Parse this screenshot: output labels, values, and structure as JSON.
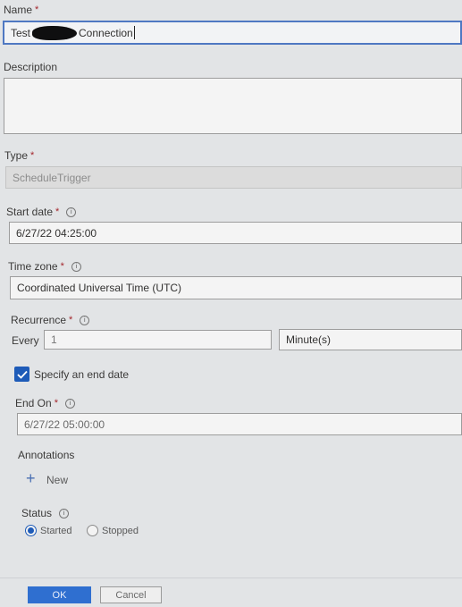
{
  "name": {
    "label": "Name",
    "required_mark": "*",
    "value_prefix": "Test",
    "value_suffix": "Connection"
  },
  "description": {
    "label": "Description",
    "value": ""
  },
  "type": {
    "label": "Type",
    "required_mark": "*",
    "value": "ScheduleTrigger"
  },
  "start_date": {
    "label": "Start date",
    "required_mark": "*",
    "value": "6/27/22 04:25:00"
  },
  "time_zone": {
    "label": "Time zone",
    "required_mark": "*",
    "value": "Coordinated Universal Time (UTC)"
  },
  "recurrence": {
    "label": "Recurrence",
    "required_mark": "*",
    "every_label": "Every",
    "interval": "1",
    "unit": "Minute(s)"
  },
  "end_date_toggle": {
    "label": "Specify an end date",
    "checked": true
  },
  "end_on": {
    "label": "End On",
    "required_mark": "*",
    "value": "6/27/22 05:00:00"
  },
  "annotations": {
    "label": "Annotations",
    "new_label": "New"
  },
  "status": {
    "label": "Status",
    "options": [
      "Started",
      "Stopped"
    ],
    "selected": "Started"
  },
  "footer": {
    "ok_label": "OK",
    "cancel_label": "Cancel"
  },
  "colors": {
    "accent": "#2f6fd0",
    "focus_border": "#4f78c2",
    "required": "#a4262c"
  }
}
